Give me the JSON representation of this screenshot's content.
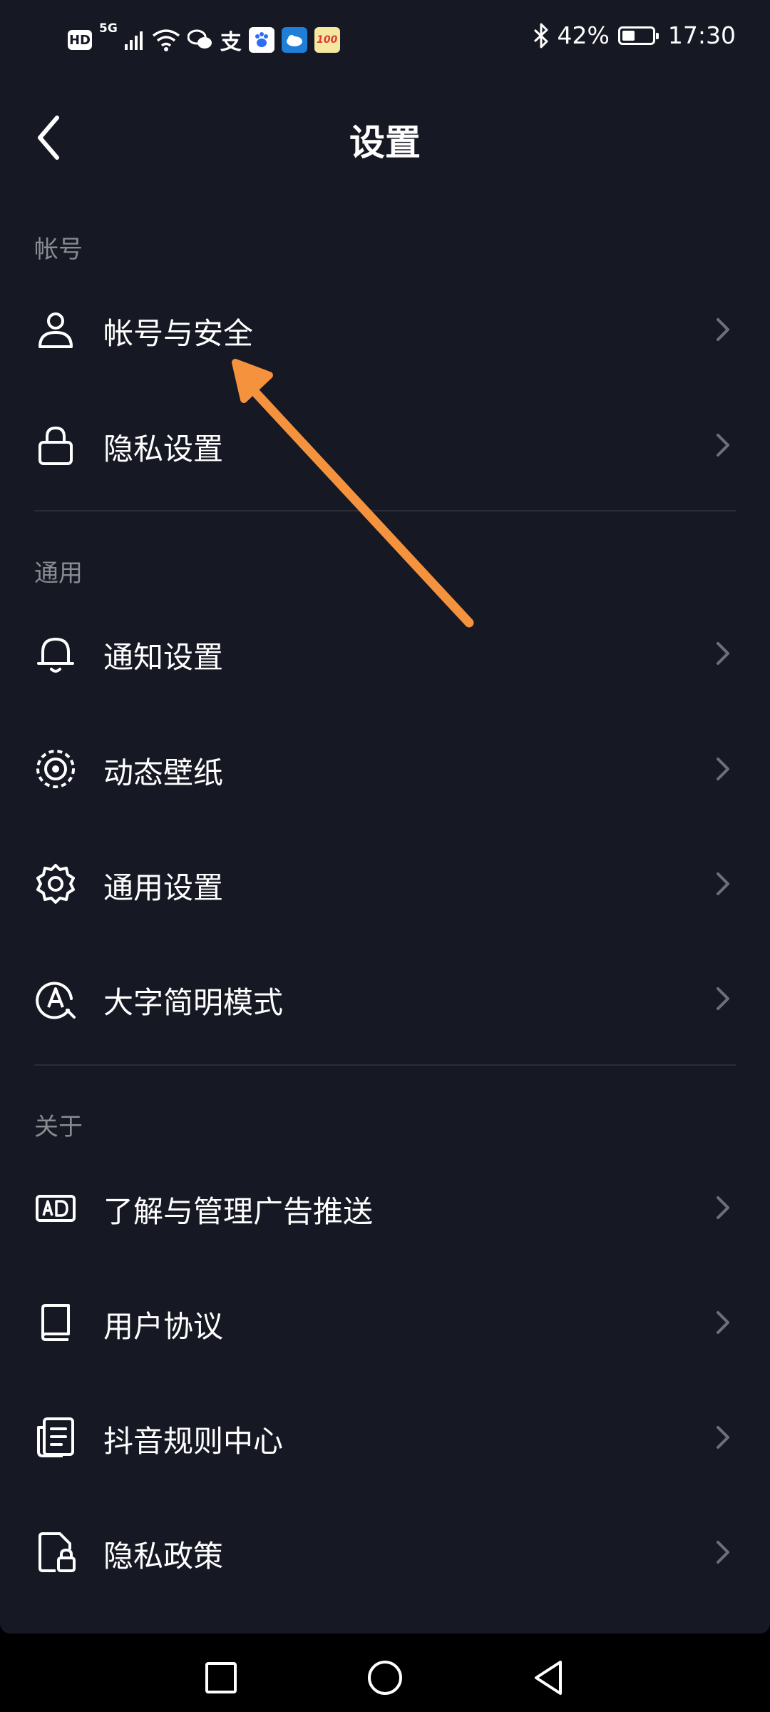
{
  "status_bar": {
    "hd": "HD",
    "network": "5G",
    "alipay_glyph": "支",
    "app100_glyph": "100",
    "battery_pct": "42%",
    "battery_level": 0.42,
    "time": "17:30"
  },
  "header": {
    "title": "设置"
  },
  "sections": {
    "account": {
      "title": "帐号",
      "items": [
        {
          "label": "帐号与安全",
          "icon": "user-icon"
        },
        {
          "label": "隐私设置",
          "icon": "lock-icon"
        }
      ]
    },
    "general": {
      "title": "通用",
      "items": [
        {
          "label": "通知设置",
          "icon": "bell-icon"
        },
        {
          "label": "动态壁纸",
          "icon": "live-wallpaper-icon"
        },
        {
          "label": "通用设置",
          "icon": "gear-icon"
        },
        {
          "label": "大字简明模式",
          "icon": "large-font-icon"
        }
      ]
    },
    "about": {
      "title": "关于",
      "items": [
        {
          "label": "了解与管理广告推送",
          "icon": "ad-icon"
        },
        {
          "label": "用户协议",
          "icon": "book-icon"
        },
        {
          "label": "抖音规则中心",
          "icon": "rules-document-icon"
        },
        {
          "label": "隐私政策",
          "icon": "privacy-document-icon"
        }
      ]
    }
  },
  "colors": {
    "background": "#161823",
    "annotation_arrow": "#F5923E",
    "section_title": "#8A8B91"
  }
}
